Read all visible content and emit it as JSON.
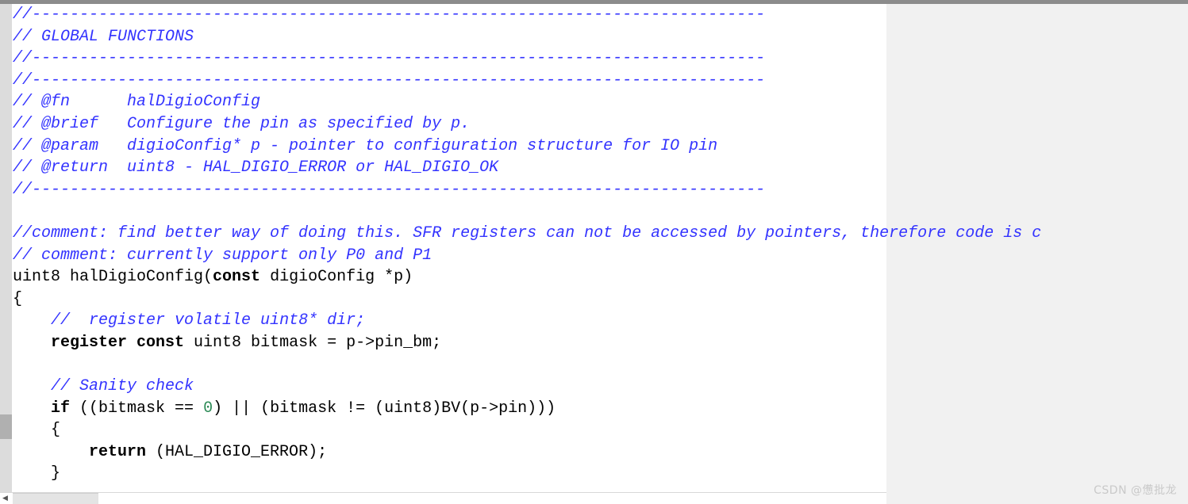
{
  "window": {
    "scrollbars": {
      "vertical_present": true,
      "horizontal_present": true,
      "h_arrow_glyph": "◀"
    }
  },
  "editor": {
    "language": "c",
    "colors": {
      "comment": "#3333ff",
      "keyword": "#000000",
      "number": "#2e8b57",
      "text": "#000000",
      "background": "#ffffff",
      "page_background": "#f1f1f1",
      "scrollbar_track": "#dcdcdc",
      "scrollbar_thumb": "#b0b0b0"
    },
    "lines": [
      {
        "id": 1,
        "tokens": [
          {
            "t": "comment",
            "v": "//-----------------------------------------------------------------------------"
          }
        ]
      },
      {
        "id": 2,
        "tokens": [
          {
            "t": "comment",
            "v": "// GLOBAL FUNCTIONS"
          }
        ]
      },
      {
        "id": 3,
        "tokens": [
          {
            "t": "comment",
            "v": "//-----------------------------------------------------------------------------"
          }
        ]
      },
      {
        "id": 4,
        "tokens": [
          {
            "t": "comment",
            "v": "//-----------------------------------------------------------------------------"
          }
        ]
      },
      {
        "id": 5,
        "tokens": [
          {
            "t": "comment",
            "v": "// @fn      halDigioConfig"
          }
        ]
      },
      {
        "id": 6,
        "tokens": [
          {
            "t": "comment",
            "v": "// @brief   Configure the pin as specified by p."
          }
        ]
      },
      {
        "id": 7,
        "tokens": [
          {
            "t": "comment",
            "v": "// @param   digioConfig* p - pointer to configuration structure for IO pin"
          }
        ]
      },
      {
        "id": 8,
        "tokens": [
          {
            "t": "comment",
            "v": "// @return  uint8 - HAL_DIGIO_ERROR or HAL_DIGIO_OK"
          }
        ]
      },
      {
        "id": 9,
        "tokens": [
          {
            "t": "comment",
            "v": "//-----------------------------------------------------------------------------"
          }
        ]
      },
      {
        "id": 10,
        "tokens": [
          {
            "t": "text",
            "v": ""
          }
        ]
      },
      {
        "id": 11,
        "tokens": [
          {
            "t": "comment",
            "v": "//comment: find better way of doing this. SFR registers can not be accessed by pointers, therefore code is c"
          }
        ]
      },
      {
        "id": 12,
        "tokens": [
          {
            "t": "comment",
            "v": "// comment: currently support only P0 and P1"
          }
        ]
      },
      {
        "id": 13,
        "tokens": [
          {
            "t": "text",
            "v": "uint8 halDigioConfig("
          },
          {
            "t": "keyword",
            "v": "const"
          },
          {
            "t": "text",
            "v": " digioConfig *p)"
          }
        ]
      },
      {
        "id": 14,
        "tokens": [
          {
            "t": "text",
            "v": "{"
          }
        ]
      },
      {
        "id": 15,
        "tokens": [
          {
            "t": "text",
            "v": "    "
          },
          {
            "t": "comment",
            "v": "//  register volatile uint8* dir;"
          }
        ]
      },
      {
        "id": 16,
        "tokens": [
          {
            "t": "text",
            "v": "    "
          },
          {
            "t": "keyword",
            "v": "register const"
          },
          {
            "t": "text",
            "v": " uint8 bitmask = p->pin_bm;"
          }
        ]
      },
      {
        "id": 17,
        "tokens": [
          {
            "t": "text",
            "v": ""
          }
        ]
      },
      {
        "id": 18,
        "tokens": [
          {
            "t": "text",
            "v": "    "
          },
          {
            "t": "comment",
            "v": "// Sanity check"
          }
        ]
      },
      {
        "id": 19,
        "tokens": [
          {
            "t": "text",
            "v": "    "
          },
          {
            "t": "keyword",
            "v": "if"
          },
          {
            "t": "text",
            "v": " ((bitmask == "
          },
          {
            "t": "number",
            "v": "0"
          },
          {
            "t": "text",
            "v": ") || (bitmask != (uint8)BV(p->pin)))"
          }
        ]
      },
      {
        "id": 20,
        "tokens": [
          {
            "t": "text",
            "v": "    {"
          }
        ]
      },
      {
        "id": 21,
        "tokens": [
          {
            "t": "text",
            "v": "        "
          },
          {
            "t": "keyword",
            "v": "return"
          },
          {
            "t": "text",
            "v": " (HAL_DIGIO_ERROR);"
          }
        ]
      },
      {
        "id": 22,
        "tokens": [
          {
            "t": "text",
            "v": "    }"
          }
        ]
      }
    ]
  },
  "watermark": {
    "text": "CSDN @憊批龙"
  }
}
